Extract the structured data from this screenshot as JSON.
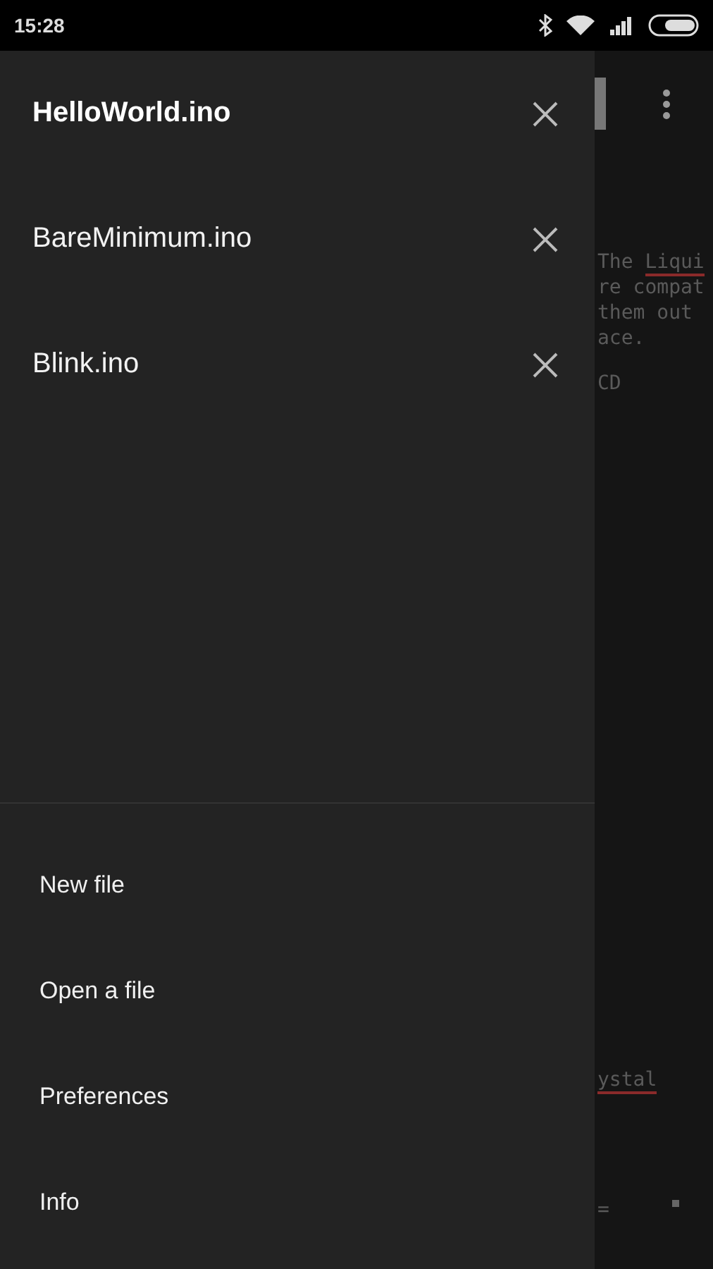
{
  "status_bar": {
    "time": "15:28"
  },
  "drawer": {
    "files": [
      {
        "name": "HelloWorld.ino",
        "selected": true
      },
      {
        "name": "BareMinimum.ino",
        "selected": false
      },
      {
        "name": "Blink.ino",
        "selected": false
      }
    ],
    "menu": [
      "New file",
      "Open a file",
      "Preferences",
      "Info"
    ]
  },
  "editor": {
    "blocks": [
      {
        "lines": [
          [
            {
              "text": "The ",
              "misspelled": false
            },
            {
              "text": "Liqui",
              "misspelled": true
            }
          ],
          [
            {
              "text": "re compat",
              "misspelled": false
            }
          ],
          [
            {
              "text": "them out",
              "misspelled": false
            }
          ],
          [
            {
              "text": "ace.",
              "misspelled": false
            }
          ]
        ]
      },
      {
        "lines": [
          [
            {
              "text": "CD",
              "misspelled": false
            }
          ]
        ]
      },
      {
        "lines": [
          [
            {
              "text": "ystal",
              "misspelled": true
            }
          ]
        ]
      },
      {
        "lines": [
          [
            {
              "text": "=",
              "misspelled": false
            }
          ]
        ]
      }
    ]
  }
}
